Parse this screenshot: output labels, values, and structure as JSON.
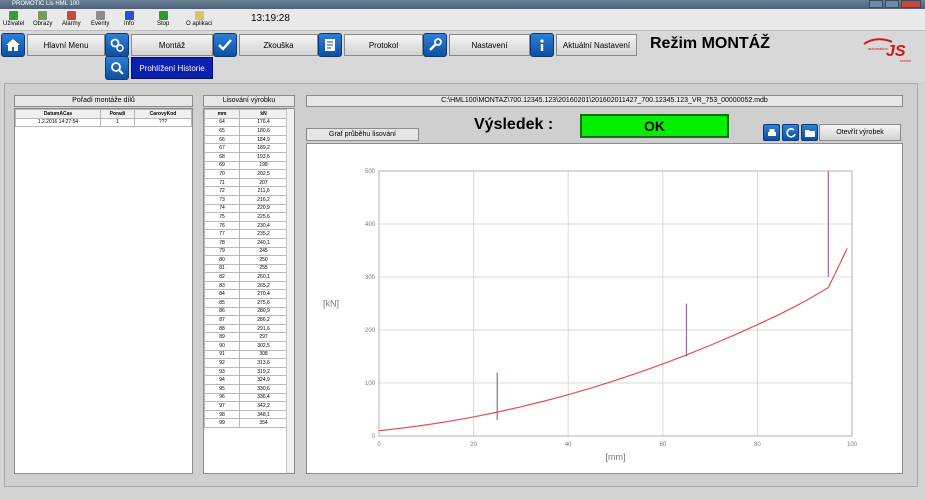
{
  "window": {
    "title": "PROMOTIC Lis HML 100"
  },
  "toolbar": {
    "items": [
      {
        "label": "Uživatel",
        "icon": "user-icon"
      },
      {
        "label": "Obrazy",
        "icon": "images-icon"
      },
      {
        "label": "Alarmy",
        "icon": "alarm-icon"
      },
      {
        "label": "Eventy",
        "icon": "events-icon"
      },
      {
        "label": "Info",
        "icon": "info-icon"
      },
      {
        "label": "Stop",
        "icon": "stop-icon"
      },
      {
        "label": "O aplikaci",
        "icon": "about-icon"
      }
    ],
    "clock": "13:19:28"
  },
  "nav": {
    "hlavni": "Hlavní Menu",
    "montaz": "Montáž",
    "zkouska": "Zkouška",
    "protokol": "Protokol",
    "nastaveni": "Nastavení",
    "aktualni": "Aktuální Nastavení",
    "submenu": "Prohlížení Historie"
  },
  "mode_title": "Režim MONTÁŽ",
  "logo": {
    "text": "JS",
    "subtext": "automation",
    "tag": "service"
  },
  "poradi": {
    "title": "Pořadí montáže dílů",
    "columns": [
      "DatumACas",
      "Poradi",
      "CarovyKod"
    ],
    "rows": [
      [
        "1.2.2016 14:27:54",
        "1",
        "???"
      ]
    ]
  },
  "lisovani": {
    "title": "Lisování výrobku",
    "columns": [
      "mm",
      "kN"
    ],
    "rows": [
      [
        "64",
        "176,4"
      ],
      [
        "65",
        "180,6"
      ],
      [
        "66",
        "184,9"
      ],
      [
        "67",
        "189,2"
      ],
      [
        "68",
        "193,6"
      ],
      [
        "69",
        "198"
      ],
      [
        "70",
        "202,5"
      ],
      [
        "71",
        "207"
      ],
      [
        "72",
        "211,6"
      ],
      [
        "73",
        "216,2"
      ],
      [
        "74",
        "220,9"
      ],
      [
        "75",
        "225,6"
      ],
      [
        "76",
        "230,4"
      ],
      [
        "77",
        "235,2"
      ],
      [
        "78",
        "240,1"
      ],
      [
        "79",
        "245"
      ],
      [
        "80",
        "250"
      ],
      [
        "81",
        "255"
      ],
      [
        "82",
        "260,1"
      ],
      [
        "83",
        "265,2"
      ],
      [
        "84",
        "270,4"
      ],
      [
        "85",
        "275,6"
      ],
      [
        "86",
        "280,9"
      ],
      [
        "87",
        "286,2"
      ],
      [
        "88",
        "291,6"
      ],
      [
        "89",
        "297"
      ],
      [
        "90",
        "302,5"
      ],
      [
        "91",
        "308"
      ],
      [
        "92",
        "313,6"
      ],
      [
        "93",
        "319,2"
      ],
      [
        "94",
        "324,9"
      ],
      [
        "95",
        "330,6"
      ],
      [
        "96",
        "336,4"
      ],
      [
        "97",
        "342,2"
      ],
      [
        "98",
        "348,1"
      ],
      [
        "99",
        "354"
      ]
    ]
  },
  "file_path": "C:\\HML100\\MONTAZ\\700.12345.123\\20160201\\201602011427_700.12345.123_VR_753_00000052.mdb",
  "vysledek": {
    "label": "Výsledek :",
    "value": "OK",
    "color": "#00f000"
  },
  "graf_tab": "Graf průběhu lisování",
  "buttons": {
    "otevrit": "Otevřít výrobek"
  },
  "chart_data": {
    "type": "line",
    "xlabel": "[mm]",
    "ylabel": "[kN]",
    "xlim": [
      0,
      100
    ],
    "ylim": [
      0,
      500
    ],
    "xticks": [
      0,
      20,
      40,
      60,
      80,
      100
    ],
    "yticks": [
      0,
      100,
      200,
      300,
      400,
      500
    ],
    "grid": true,
    "series": [
      {
        "color": "#e05050",
        "x": [
          0,
          5,
          10,
          15,
          20,
          25,
          30,
          35,
          40,
          45,
          50,
          55,
          60,
          65,
          70,
          75,
          80,
          85,
          90,
          95,
          99
        ],
        "y": [
          10,
          15,
          21,
          28,
          36,
          45,
          55,
          66,
          78,
          91,
          105,
          120,
          136,
          153,
          171,
          190,
          210,
          231,
          254,
          280,
          354
        ]
      }
    ],
    "limit_markers": [
      {
        "x": 25,
        "ymin": 30,
        "ymax": 120
      },
      {
        "x": 65,
        "ymin": 150,
        "ymax": 250
      },
      {
        "x": 95,
        "ymin": 300,
        "ymax": 500
      }
    ],
    "marker_color": "#a070b0"
  }
}
